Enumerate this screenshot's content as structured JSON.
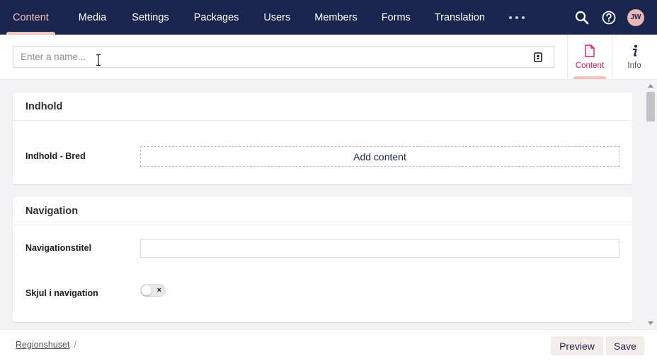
{
  "nav": {
    "items": [
      {
        "label": "Content",
        "active": true
      },
      {
        "label": "Media"
      },
      {
        "label": "Settings"
      },
      {
        "label": "Packages"
      },
      {
        "label": "Users"
      },
      {
        "label": "Members"
      },
      {
        "label": "Forms"
      },
      {
        "label": "Translation"
      }
    ],
    "more_icon": "ellipsis-icon",
    "search_icon": "search-icon",
    "help_icon": "help-icon",
    "user_initials": "JW"
  },
  "editor": {
    "name_placeholder": "Enter a name...",
    "name_value": "",
    "apps": [
      {
        "label": "Content",
        "icon": "document-icon"
      },
      {
        "label": "Info",
        "icon": "info-icon"
      }
    ]
  },
  "groups": [
    {
      "title": "Indhold",
      "properties": [
        {
          "label": "Indhold - Bred",
          "action_label": "Add content"
        }
      ]
    },
    {
      "title": "Navigation",
      "properties": [
        {
          "label": "Navigationstitel",
          "value": ""
        },
        {
          "label": "Skjul i navigation",
          "toggle": false
        }
      ]
    }
  ],
  "footer": {
    "breadcrumb": [
      "Regionshuset"
    ],
    "separator": "/",
    "preview_label": "Preview",
    "save_label": "Save"
  },
  "colors": {
    "nav_background": "#1b264f",
    "accent": "#f5c1bc",
    "active_tab": "#d42054",
    "button_background": "#f3ece8"
  }
}
